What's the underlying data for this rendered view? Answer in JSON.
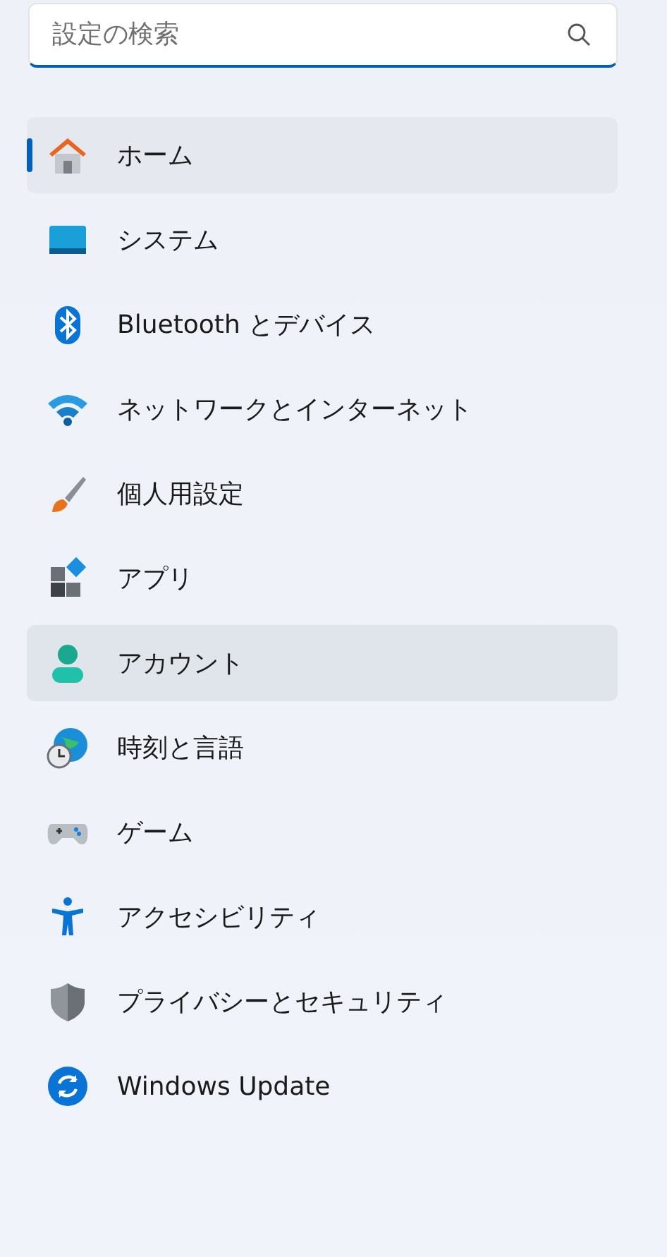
{
  "search": {
    "placeholder": "設定の検索"
  },
  "nav": [
    {
      "kind": "home",
      "label": "ホーム",
      "selected": true,
      "hovered": false
    },
    {
      "kind": "system",
      "label": "システム",
      "selected": false,
      "hovered": false
    },
    {
      "kind": "bluetooth",
      "label": "Bluetooth とデバイス",
      "selected": false,
      "hovered": false
    },
    {
      "kind": "network",
      "label": "ネットワークとインターネット",
      "selected": false,
      "hovered": false
    },
    {
      "kind": "personalize",
      "label": "個人用設定",
      "selected": false,
      "hovered": false
    },
    {
      "kind": "apps",
      "label": "アプリ",
      "selected": false,
      "hovered": false
    },
    {
      "kind": "account",
      "label": "アカウント",
      "selected": false,
      "hovered": true
    },
    {
      "kind": "time",
      "label": "時刻と言語",
      "selected": false,
      "hovered": false
    },
    {
      "kind": "game",
      "label": "ゲーム",
      "selected": false,
      "hovered": false
    },
    {
      "kind": "access",
      "label": "アクセシビリティ",
      "selected": false,
      "hovered": false
    },
    {
      "kind": "privacy",
      "label": "プライバシーとセキュリティ",
      "selected": false,
      "hovered": false
    },
    {
      "kind": "update",
      "label": "Windows Update",
      "selected": false,
      "hovered": false
    }
  ]
}
